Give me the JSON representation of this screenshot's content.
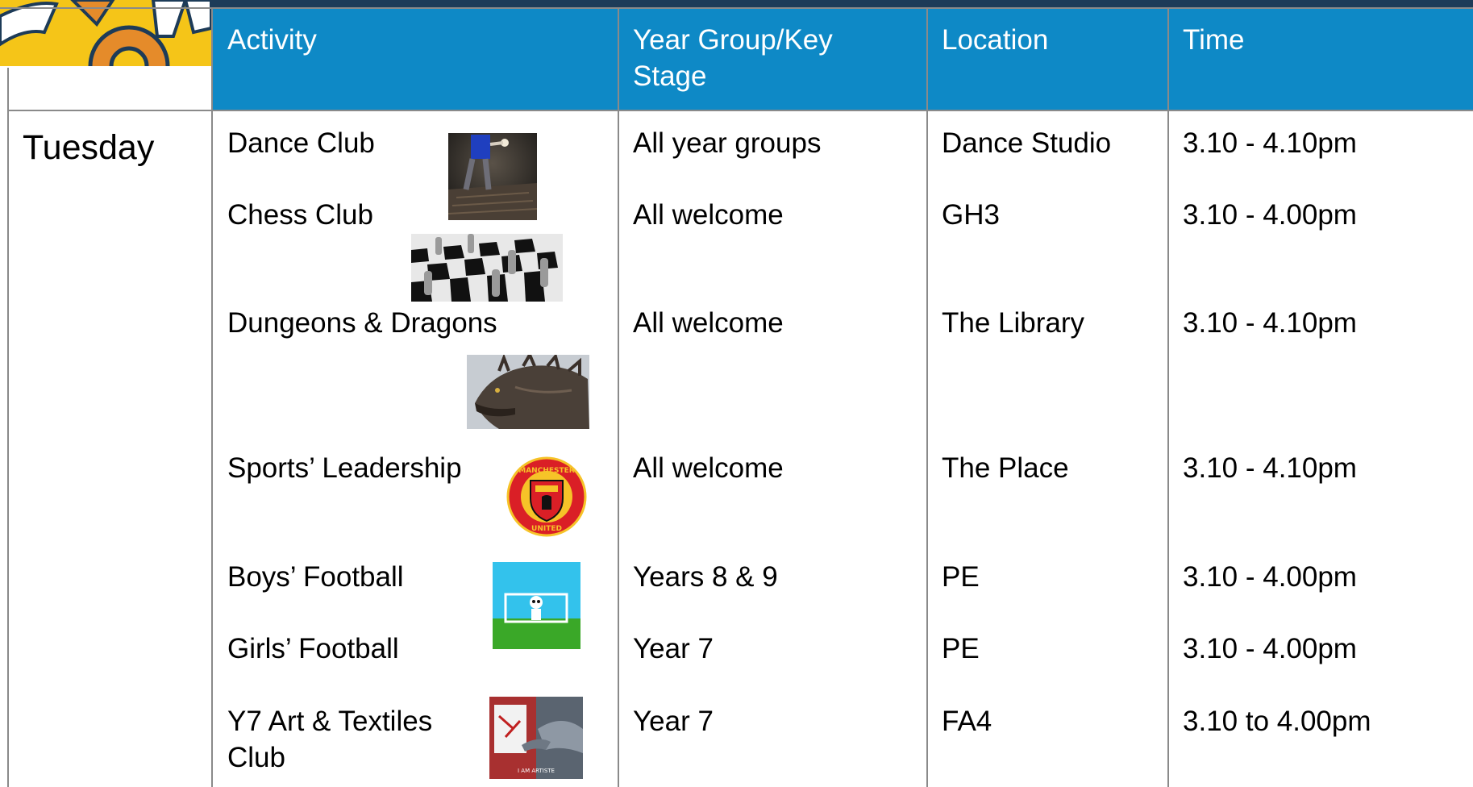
{
  "table": {
    "headers": [
      "Activity",
      "Year Group/Key Stage",
      "Location",
      "Time"
    ],
    "day": "Tuesday",
    "rows": [
      {
        "activity": "Dance Club",
        "group": "All year groups",
        "location": "Dance Studio",
        "time": "3.10 - 4.10pm",
        "image": "dancer-photo"
      },
      {
        "activity": "Chess Club",
        "group": "All welcome",
        "location": "GH3",
        "time": "3.10 - 4.00pm",
        "image": "chessboard-photo"
      },
      {
        "activity": "Dungeons & Dragons",
        "group": "All welcome",
        "location": "The Library",
        "time": "3.10 - 4.10pm",
        "image": "dragon-photo"
      },
      {
        "activity": "Sports’ Leadership",
        "group": "All welcome",
        "location": "The Place",
        "time": "3.10 - 4.10pm",
        "image": "manchester-united-crest"
      },
      {
        "activity": "Boys’ Football",
        "group": "Years 8 & 9",
        "location": "PE",
        "time": "3.10 - 4.00pm",
        "image": "football-goal-illustration"
      },
      {
        "activity": "Girls’ Football",
        "group": "Year 7",
        "location": "PE",
        "time": "3.10 - 4.00pm",
        "image": ""
      },
      {
        "activity": "Y7 Art & Textiles Club",
        "group": "Year 7",
        "location": "FA4",
        "time": "3.10 to 4.00pm",
        "image": "dolphin-artist-photo"
      }
    ],
    "crest_text": [
      "MANCHESTER",
      "UNITED"
    ],
    "art_caption": "I AM ARTISTE"
  },
  "colors": {
    "header_blue": "#0e89c6",
    "top_band": "#1d3b58",
    "logo_yellow": "#f5c518",
    "grid_line": "#8a8a8a"
  }
}
